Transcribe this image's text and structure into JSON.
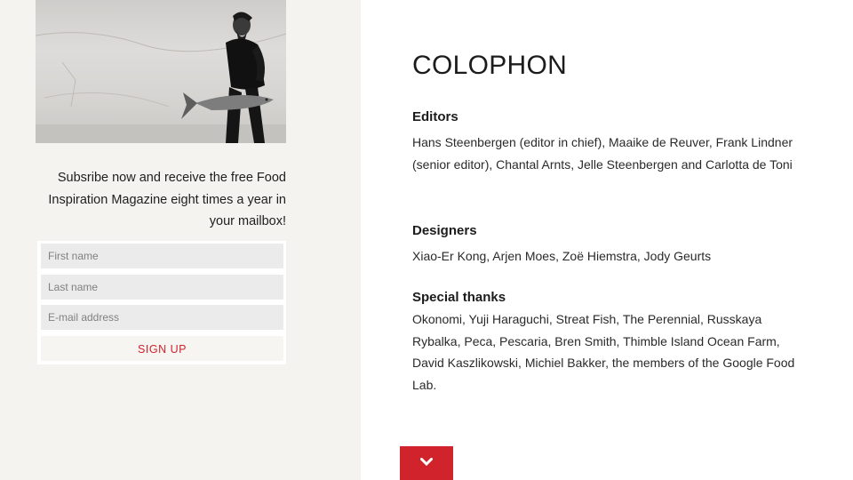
{
  "subscribe": {
    "promo_text": "Subsribe now and receive the free Food Inspiration Magazine eight times a year in your mailbox!",
    "first_name_placeholder": "First name",
    "last_name_placeholder": "Last name",
    "email_placeholder": "E-mail address",
    "signup_label": "SIGN UP"
  },
  "colophon": {
    "title": "COLOPHON",
    "sections": [
      {
        "heading": "Editors",
        "body": "Hans Steenbergen (editor in chief), Maaike de Reuver, Frank Lindner (senior editor), Chantal Arnts, Jelle Steenbergen and Carlotta de Toni"
      },
      {
        "heading": "Designers",
        "body": "Xiao-Er Kong, Arjen Moes, Zoë Hiemstra, Jody Geurts"
      },
      {
        "heading": "Special thanks",
        "body": "Okonomi, Yuji Haraguchi, Streat Fish, The Perennial, Russkaya Rybalka, Peca, Pescaria, Bren Smith, Thimble Island Ocean Farm, David Kaszlikowski, Michiel Bakker, the members of the Google Food Lab."
      }
    ]
  },
  "scroll_down": {
    "icon": "chevron-down-icon"
  },
  "colors": {
    "accent": "#d0232b",
    "panel_background": "#f4f3ef",
    "input_background": "#ebebeb"
  }
}
